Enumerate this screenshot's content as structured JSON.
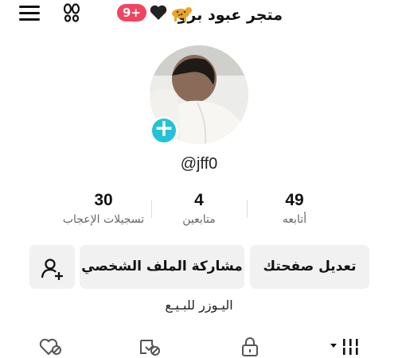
{
  "header": {
    "title": "متجر عبود برو",
    "notification_badge": "9+",
    "icons": [
      "menu-icon",
      "footprint-icon",
      "leopard-emoji",
      "black-heart-emoji"
    ]
  },
  "profile": {
    "username": "@jff0",
    "stats": [
      {
        "value": "49",
        "label": "أتابعه"
      },
      {
        "value": "4",
        "label": "متابعين"
      },
      {
        "value": "30",
        "label": "تسجيلات الإعجاب"
      }
    ],
    "buttons": {
      "edit": "تعديل صفحتك",
      "share": "مشاركة الملف الشخصي"
    },
    "bio": "اليـوزر للبـيـع"
  },
  "tabs": [
    "videos-grid-icon",
    "lock-icon",
    "reposts-icon",
    "liked-icon"
  ],
  "colors": {
    "badge": "#f1455f",
    "add_avatar": "#22c2d8",
    "button_bg": "#f1f1f2"
  }
}
